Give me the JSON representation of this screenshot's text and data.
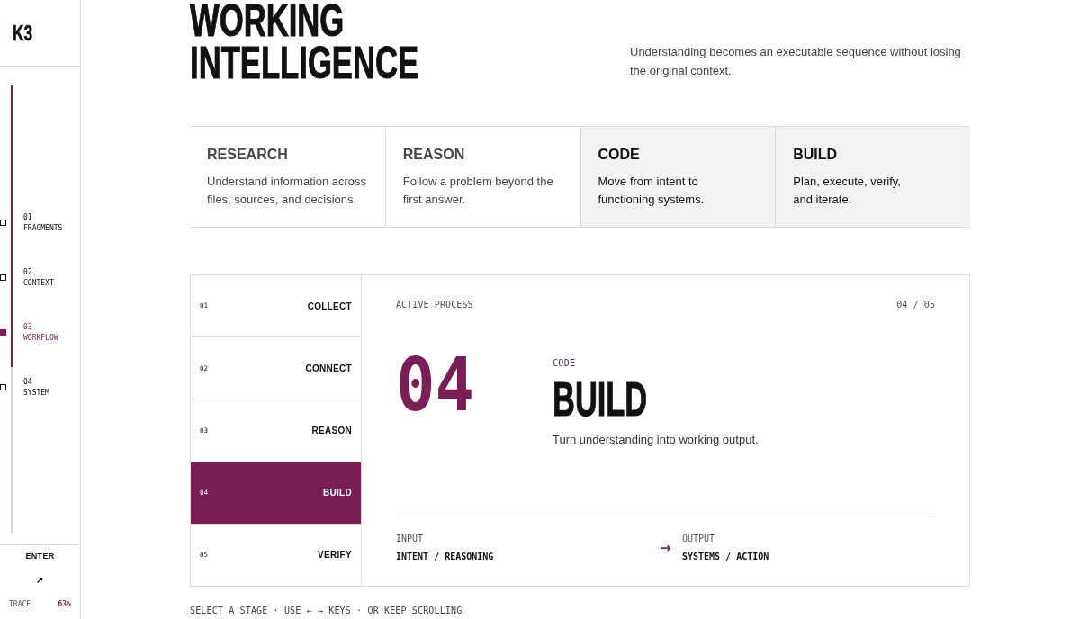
{
  "sidebar": {
    "logo": "K3",
    "progress": {
      "level": 0.63
    },
    "sections": [
      {
        "number": "01",
        "label": "FRAGMENTS",
        "selected": false
      },
      {
        "number": "02",
        "label": "CONTEXT",
        "selected": false
      },
      {
        "number": "03",
        "label": "WORKFLOW",
        "selected": true
      },
      {
        "number": "04",
        "label": "SYSTEM",
        "selected": false
      }
    ],
    "enter": {
      "label": "ENTER",
      "arrow": "↗"
    },
    "trace": {
      "label": "TRACE",
      "value": "63%"
    }
  },
  "hero": {
    "title": "WORKING INTELLIGENCE",
    "description": "Understanding becomes an executable sequence without losing\nthe original context."
  },
  "capabilities": [
    {
      "title": "RESEARCH",
      "description": "Understand information across\nfiles, sources, and decisions.",
      "highlighted": false
    },
    {
      "title": "REASON",
      "description": "Follow a problem beyond the\nfirst answer.",
      "highlighted": false
    },
    {
      "title": "CODE",
      "description": "Move from intent to\nfunctioning systems.",
      "highlighted": true
    },
    {
      "title": "BUILD",
      "description": "Plan, execute, verify,\nand iterate.",
      "highlighted": true
    }
  ],
  "process": {
    "stages": [
      {
        "number": "01",
        "label": "COLLECT",
        "selected": false
      },
      {
        "number": "02",
        "label": "CONNECT",
        "selected": false
      },
      {
        "number": "03",
        "label": "REASON",
        "selected": false
      },
      {
        "number": "04",
        "label": "BUILD",
        "selected": true
      },
      {
        "number": "05",
        "label": "VERIFY",
        "selected": false
      }
    ],
    "detail": {
      "eyebrow": "ACTIVE PROCESS",
      "counter": "04 / 05",
      "number": "04",
      "category": "CODE",
      "title": "BUILD",
      "description": "Turn understanding into working output.",
      "input": {
        "label": "INPUT",
        "value": "INTENT / REASONING"
      },
      "arrow": "→",
      "output": {
        "label": "OUTPUT",
        "value": "SYSTEMS / ACTION"
      }
    }
  },
  "hint": "SELECT A STAGE · USE ← → KEYS · OR KEEP SCROLLING"
}
